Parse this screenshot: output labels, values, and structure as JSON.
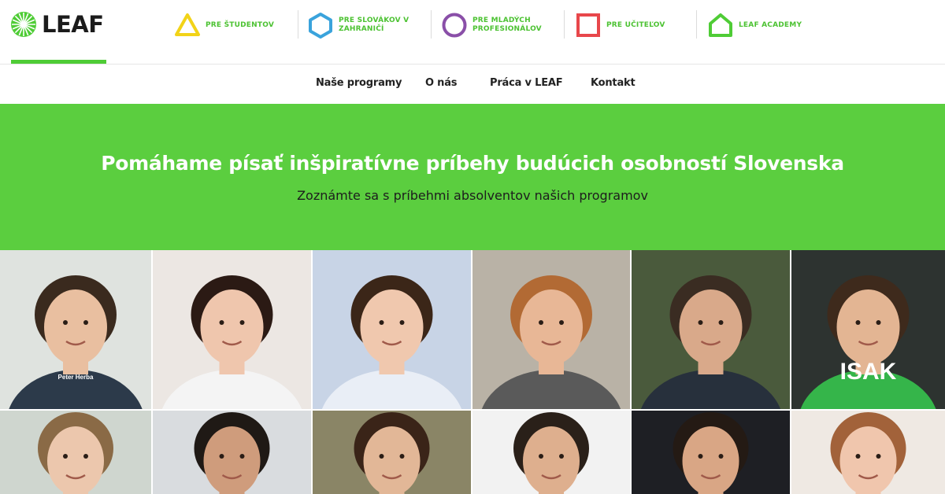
{
  "brand": {
    "name": "LEAF",
    "accent": "#5bce3f",
    "label_green": "#4cc232"
  },
  "segments": [
    {
      "label": "PRE ŠTUDENTOV",
      "icon": "triangle-icon",
      "color": "#f2d318"
    },
    {
      "label": "PRE SLOVÁKOV V\nZAHRANIČÍ",
      "icon": "hexagon-icon",
      "color": "#3aa3dc"
    },
    {
      "label": "PRE MLADÝCH\nPROFESIONÁLOV",
      "icon": "circle-icon",
      "color": "#8a4fa8"
    },
    {
      "label": "PRE UČITEĽOV",
      "icon": "square-icon",
      "color": "#e8474b"
    },
    {
      "label": "LEAF ACADEMY",
      "icon": "house-icon",
      "color": "#4fcc36"
    }
  ],
  "nav": {
    "items": [
      "Naše programy",
      "O nás",
      "Práca v LEAF",
      "Kontakt"
    ]
  },
  "hero": {
    "title": "Pomáhame písať inšpiratívne príbehy budúcich osobností Slovenska",
    "subtitle": "Zoznámte sa s príbehmi absolventov našich programov",
    "background": "#5bce3f"
  },
  "gallery": {
    "row1": [
      {
        "bg": "#dfe3df",
        "skin": "#e9bfa0",
        "hair": "#3a2a1e",
        "shirt": "#2c3a4a",
        "badge": "Peter Herba"
      },
      {
        "bg": "#ece7e3",
        "skin": "#efc6ad",
        "hair": "#2b1a14",
        "shirt": "#f4f4f4",
        "badge": ""
      },
      {
        "bg": "#c8d4e6",
        "skin": "#f0c8ae",
        "hair": "#3b2618",
        "shirt": "#e9eef6",
        "badge": ""
      },
      {
        "bg": "#b9b2a6",
        "skin": "#e8b796",
        "hair": "#b26a34",
        "shirt": "#5a5a5a",
        "badge": ""
      },
      {
        "bg": "#4a5a3c",
        "skin": "#d9a98a",
        "hair": "#3a2c22",
        "shirt": "#27303c",
        "badge": ""
      },
      {
        "bg": "#2d3330",
        "skin": "#e3b593",
        "hair": "#3e2a1c",
        "shirt": "#35b54a",
        "badge": "ISAK"
      }
    ],
    "row2": [
      {
        "bg": "#cfd6cf",
        "skin": "#ecc7ad",
        "hair": "#8a6a46"
      },
      {
        "bg": "#d9dcdf",
        "skin": "#cf9c7c",
        "hair": "#1f1915"
      },
      {
        "bg": "#8a8566",
        "skin": "#e2b797",
        "hair": "#3a2418"
      },
      {
        "bg": "#f2f2f2",
        "skin": "#deaf8e",
        "hair": "#2a2019"
      },
      {
        "bg": "#1e1f24",
        "skin": "#d9a685",
        "hair": "#241a14"
      },
      {
        "bg": "#efe9e3",
        "skin": "#f0c6ad",
        "hair": "#a2623a"
      }
    ]
  }
}
